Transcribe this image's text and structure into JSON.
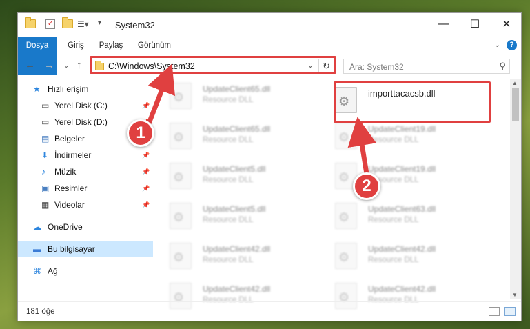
{
  "window": {
    "title": "System32"
  },
  "window_buttons": {
    "minimize": "—",
    "maximize": "☐",
    "close": "✕"
  },
  "ribbon": {
    "tabs": [
      "Dosya",
      "Giriş",
      "Paylaş",
      "Görünüm"
    ],
    "help": "?"
  },
  "nav": {
    "address": "C:\\Windows\\System32",
    "search_placeholder": "Ara: System32"
  },
  "sidebar": {
    "items": [
      {
        "label": "Hızlı erişim",
        "icon": "star-icon",
        "pinned": false,
        "root": true
      },
      {
        "label": "Yerel Disk (C:)",
        "icon": "drive-icon",
        "pinned": true
      },
      {
        "label": "Yerel Disk (D:)",
        "icon": "drive-icon",
        "pinned": true
      },
      {
        "label": "Belgeler",
        "icon": "documents-icon",
        "pinned": true
      },
      {
        "label": "İndirmeler",
        "icon": "download-icon",
        "pinned": true
      },
      {
        "label": "Müzik",
        "icon": "music-icon",
        "pinned": true
      },
      {
        "label": "Resimler",
        "icon": "pictures-icon",
        "pinned": true
      },
      {
        "label": "Videolar",
        "icon": "video-icon",
        "pinned": true
      },
      {
        "label": "OneDrive",
        "icon": "cloud-icon",
        "root": true
      },
      {
        "label": "Bu bilgisayar",
        "icon": "computer-icon",
        "root": true,
        "selected": true
      },
      {
        "label": "Ağ",
        "icon": "network-icon",
        "root": true
      }
    ]
  },
  "files": {
    "left": [
      {
        "name": "UpdateClient65.dll",
        "type": "Resource DLL"
      },
      {
        "name": "UpdateClient65.dll",
        "type": "Resource DLL"
      },
      {
        "name": "UpdateClient5.dll",
        "type": "Resource DLL"
      },
      {
        "name": "UpdateClient5.dll",
        "type": "Resource DLL"
      },
      {
        "name": "UpdateClient42.dll",
        "type": "Resource DLL"
      },
      {
        "name": "UpdateClient42.dll",
        "type": "Resource DLL"
      }
    ],
    "right": [
      {
        "name": "importtacacsb.dll",
        "type": "",
        "highlighted": true
      },
      {
        "name": "UpdateClient19.dll",
        "type": "Resource DLL"
      },
      {
        "name": "UpdateClient19.dll",
        "type": "Resource DLL"
      },
      {
        "name": "UpdateClient63.dll",
        "type": "Resource DLL"
      },
      {
        "name": "UpdateClient42.dll",
        "type": "Resource DLL"
      },
      {
        "name": "UpdateClient42.dll",
        "type": "Resource DLL"
      }
    ]
  },
  "status": {
    "count": "181 öğe"
  },
  "annotations": {
    "step1": "1",
    "step2": "2"
  },
  "colors": {
    "accent": "#1979ca",
    "highlight": "#e04040",
    "selected": "#cce8ff"
  }
}
